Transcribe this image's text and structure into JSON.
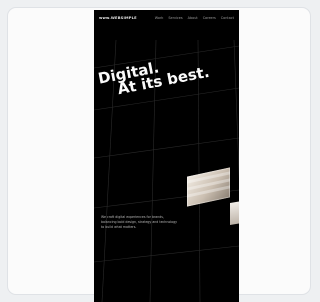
{
  "hero": {
    "logo": "www.WEBSIMPLE",
    "nav": [
      "Work",
      "Services",
      "About",
      "Careers",
      "Contact"
    ],
    "headline_line1": "Digital.",
    "headline_line2": "At its best.",
    "body_text": "We craft digital experiences for brands, balancing bold design, strategy and technology to build what matters."
  }
}
